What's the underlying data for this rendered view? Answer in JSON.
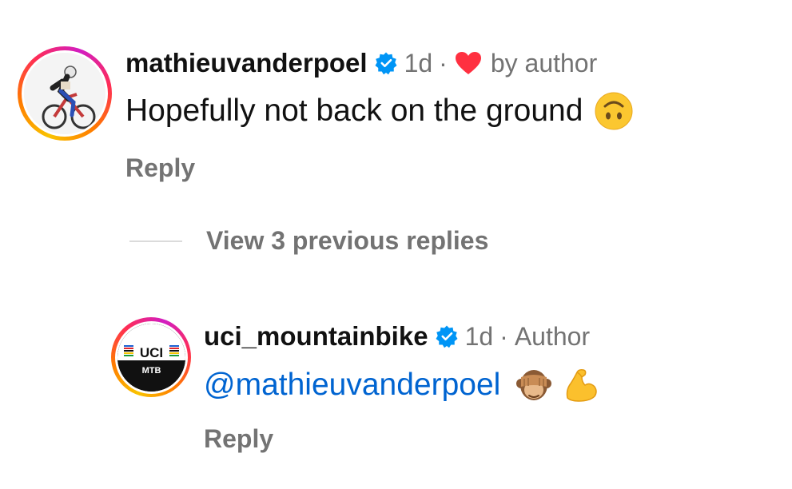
{
  "comment1": {
    "username": "mathieuvanderpoel",
    "time": "1d",
    "separator": "·",
    "liked_by_author_label": "by author",
    "text": "Hopefully not back on the ground",
    "emoji": "upside-down-face",
    "reply_label": "Reply"
  },
  "thread": {
    "view_replies_label": "View 3 previous replies"
  },
  "comment2": {
    "username": "uci_mountainbike",
    "time": "1d",
    "separator": "·",
    "author_label": "Author",
    "mention": "@mathieuvanderpoel",
    "emojis": [
      "see-no-evil-monkey",
      "flexed-biceps"
    ],
    "reply_label": "Reply",
    "avatar_logo_top": "UCI",
    "avatar_logo_bottom": "MTB"
  },
  "colors": {
    "mention": "#0064d1",
    "verified": "#0095f6",
    "heart": "#ff3040",
    "secondary_text": "#737373"
  }
}
